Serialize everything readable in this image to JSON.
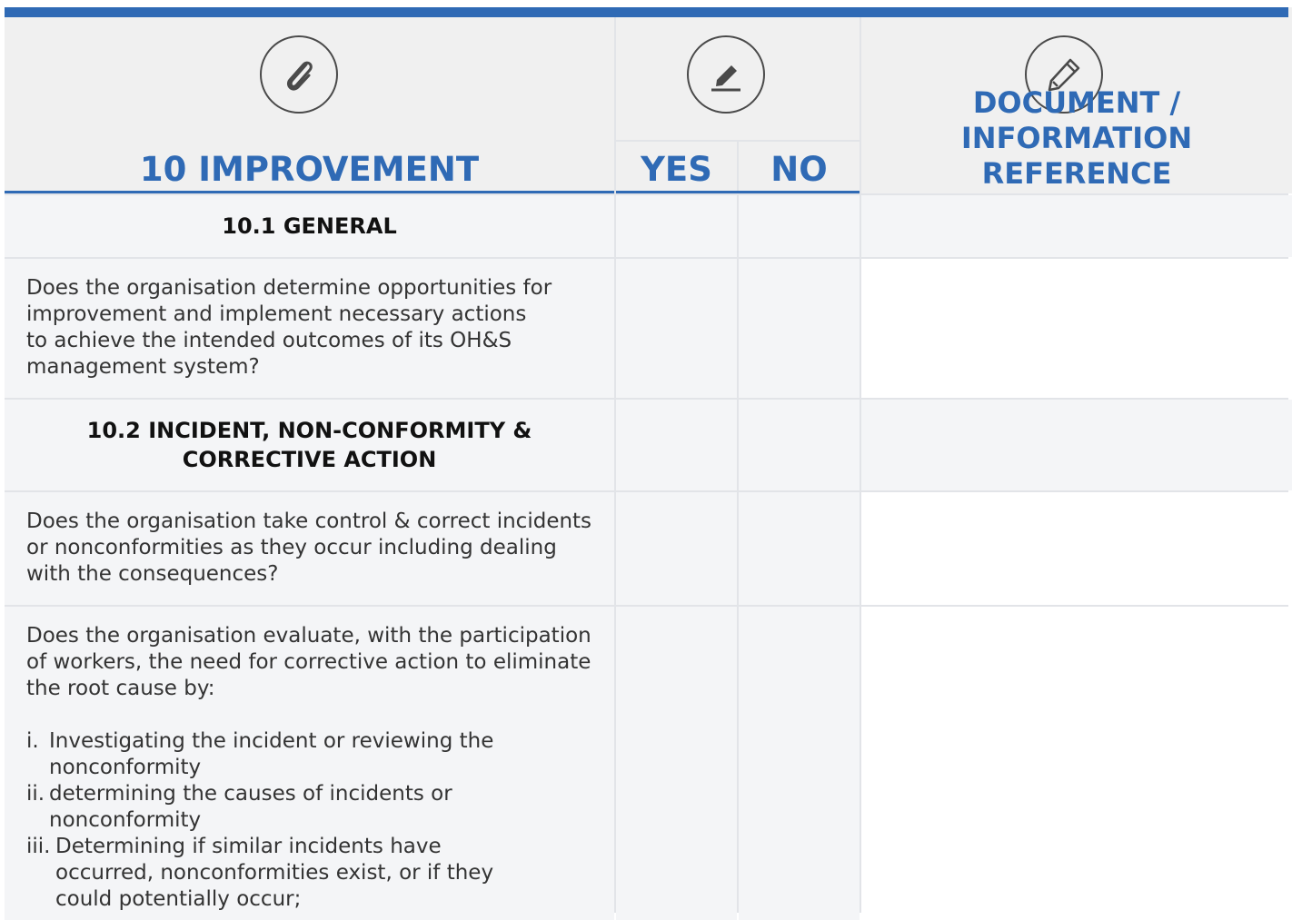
{
  "header": {
    "section_title": "10 IMPROVEMENT",
    "yes_label": "YES",
    "no_label": "NO",
    "doc_label_line1": "DOCUMENT / INFORMATION",
    "doc_label_line2": "REFERENCE",
    "icons": [
      "paperclip-icon",
      "edit-icon",
      "pencil-icon"
    ],
    "accent_color": "#2f6ab5"
  },
  "rows": [
    {
      "type": "section",
      "text": "10.1 GENERAL"
    },
    {
      "type": "question",
      "text": "Does the organisation determine opportunities for improvement and implement necessary actions to achieve the intended outcomes of its OH&S management system?"
    },
    {
      "type": "section",
      "text_line1": "10.2 INCIDENT, NON-CONFORMITY &",
      "text_line2": "CORRECTIVE ACTION"
    },
    {
      "type": "question",
      "text": "Does the organisation take control & correct incidents or nonconformities as they occur including dealing with the consequences?"
    },
    {
      "type": "question",
      "text": "Does the organisation evaluate, with the participation of workers, the need for corrective action to eliminate the root cause by:",
      "items": [
        {
          "num": "i.",
          "text": "Investigating the incident or reviewing the nonconformity"
        },
        {
          "num": "ii.",
          "text": "determining the causes of incidents or nonconformity"
        },
        {
          "num": "iii.",
          "text": "Determining if similar incidents have occurred, nonconformities exist, or if they could potentially occur;"
        }
      ]
    }
  ]
}
